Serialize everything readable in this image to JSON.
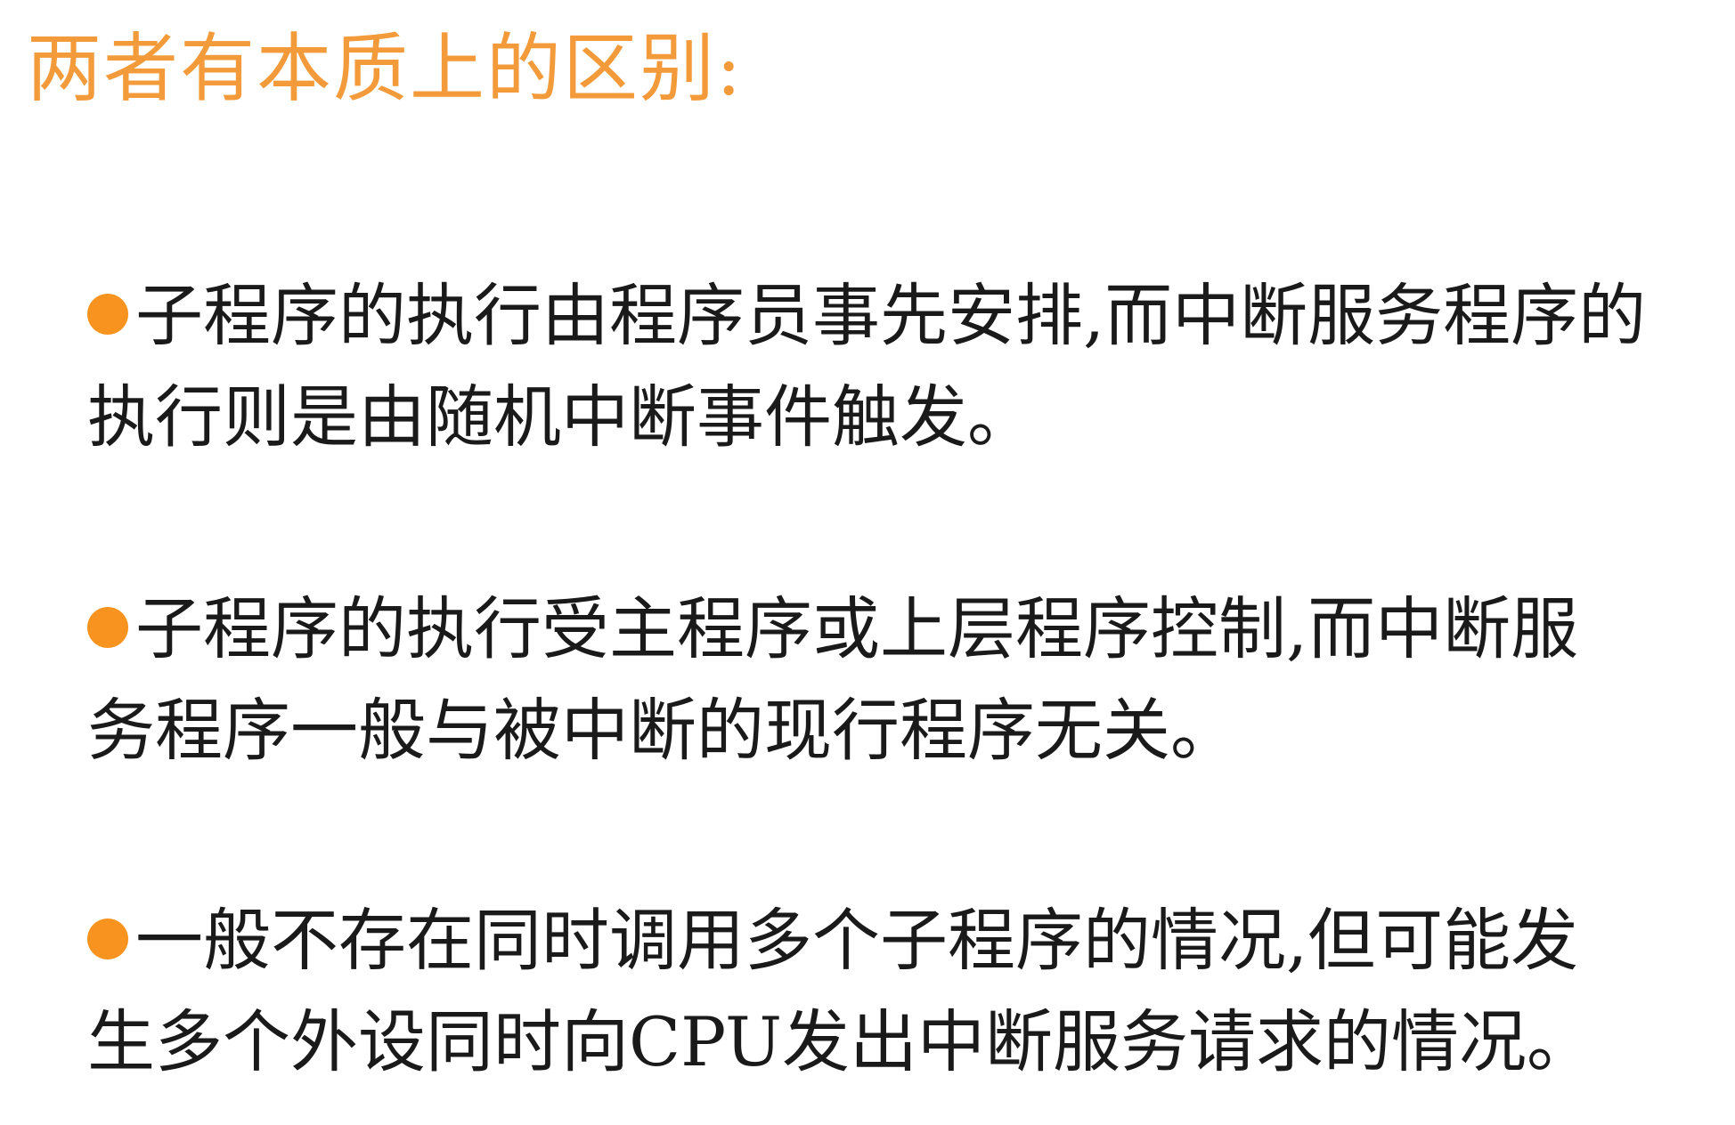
{
  "title": "两者有本质上的区别:",
  "bullets": [
    {
      "line1": "子程序的执行由程序员事先安排,而中断服务程序的",
      "line2": "执行则是由随机中断事件触发。"
    },
    {
      "line1": "子程序的执行受主程序或上层程序控制,而中断服",
      "line2": "务程序一般与被中断的现行程序无关。"
    },
    {
      "line1": "一般不存在同时调用多个子程序的情况,但可能发",
      "line2": "生多个外设同时向CPU发出中断服务请求的情况。"
    }
  ],
  "colors": {
    "title": "#f39a3a",
    "bullet_dot": "#f7931e",
    "text": "#1a1a1a"
  }
}
